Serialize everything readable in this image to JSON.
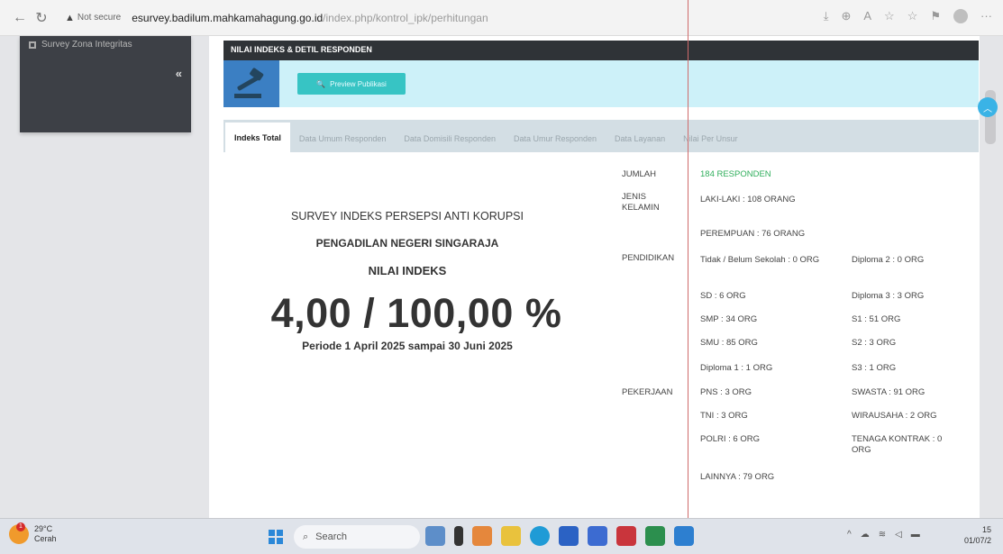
{
  "browser": {
    "not_secure": "Not secure",
    "url_domain": "esurvey.badilum.mahkamahagung.go.id",
    "url_path": "/index.php/kontrol_ipk/perhitungan"
  },
  "sidebar": {
    "menu_item": "Survey Zona Integritas",
    "collapse": "«"
  },
  "header": {
    "title": "NILAI INDEKS & DETIL RESPONDEN",
    "preview_button": "Preview Publikasi"
  },
  "tabs": [
    {
      "label": "Indeks Total"
    },
    {
      "label": "Data Umum Responden"
    },
    {
      "label": "Data Domisili Responden"
    },
    {
      "label": "Data Umur Responden"
    },
    {
      "label": "Data Layanan"
    },
    {
      "label": "Nilai Per Unsur"
    }
  ],
  "summary": {
    "survey_title": "SURVEY INDEKS PERSEPSI ANTI KORUPSI",
    "court": "PENGADILAN NEGERI SINGARAJA",
    "index_label": "NILAI INDEKS",
    "index_value": "4,00 / 100,00 %",
    "period": "Periode 1 April 2025 sampai 30 Juni 2025"
  },
  "respondents": {
    "jumlah_label": "JUMLAH",
    "jumlah_value": "184 RESPONDEN",
    "gender_label": "JENIS KELAMIN",
    "male": "LAKI-LAKI : 108 ORANG",
    "female": "PEREMPUAN : 76 ORANG",
    "education_label": "PENDIDIKAN",
    "edu_none": "Tidak / Belum Sekolah : 0 ORG",
    "edu_d2": "Diploma 2 : 0 ORG",
    "edu_sd": "SD : 6 ORG",
    "edu_d3": "Diploma 3 : 3 ORG",
    "edu_smp": "SMP : 34 ORG",
    "edu_s1": "S1 : 51 ORG",
    "edu_smu": "SMU : 85 ORG",
    "edu_s2": "S2 : 3 ORG",
    "edu_d1": "Diploma 1 : 1 ORG",
    "edu_s3": "S3 : 1 ORG",
    "job_label": "PEKERJAAN",
    "job_pns": "PNS : 3 ORG",
    "job_swasta": "SWASTA : 91 ORG",
    "job_tni": "TNI : 3 ORG",
    "job_wira": "WIRAUSAHA : 2 ORG",
    "job_polri": "POLRI : 6 ORG",
    "job_kontrak": "TENAGA KONTRAK : 0 ORG",
    "job_lain": "LAINNYA : 79 ORG"
  },
  "taskbar": {
    "temp": "29°C",
    "weather": "Cerah",
    "alert": "1",
    "search": "Search",
    "time": "15",
    "date": "01/07/2"
  },
  "colors": {
    "accent_cyan": "#37c4c4",
    "header_dark": "#2f3337",
    "green_count": "#2fae5b"
  }
}
